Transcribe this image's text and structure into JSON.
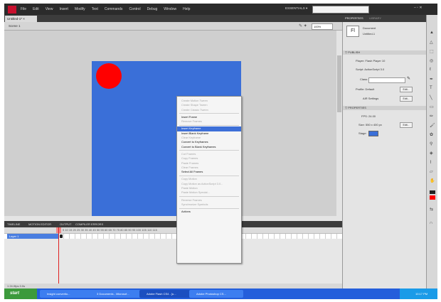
{
  "app": {
    "menu": [
      "File",
      "Edit",
      "View",
      "Insert",
      "Modify",
      "Text",
      "Commands",
      "Control",
      "Debug",
      "Window",
      "Help"
    ],
    "workspace": "ESSENTIALS ▾",
    "window_controls": "– ▫ ✕"
  },
  "document": {
    "tab": "Untitled-1* ×",
    "scene": "Scene 1",
    "zoom": "100%"
  },
  "context_menu": {
    "items": [
      {
        "label": "Create Motion Tween",
        "state": "dis"
      },
      {
        "label": "Create Shape Tween",
        "state": "dis"
      },
      {
        "label": "Create Classic Tween",
        "state": "dis"
      },
      {
        "sep": true
      },
      {
        "label": "Insert Frame",
        "state": "en"
      },
      {
        "label": "Remove Frames",
        "state": "dis"
      },
      {
        "sep": true
      },
      {
        "label": "Insert Keyframe",
        "state": "sel"
      },
      {
        "label": "Insert Blank Keyframe",
        "state": "en"
      },
      {
        "label": "Clear Keyframe",
        "state": "dis"
      },
      {
        "label": "Convert to Keyframes",
        "state": "en"
      },
      {
        "label": "Convert to Blank Keyframes",
        "state": "en"
      },
      {
        "sep": true
      },
      {
        "label": "Cut Frames",
        "state": "dis"
      },
      {
        "label": "Copy Frames",
        "state": "dis"
      },
      {
        "label": "Paste Frames",
        "state": "dis"
      },
      {
        "label": "Clear Frames",
        "state": "dis"
      },
      {
        "label": "Select All Frames",
        "state": "en"
      },
      {
        "sep": true
      },
      {
        "label": "Copy Motion",
        "state": "dis"
      },
      {
        "label": "Copy Motion as ActionScript 3.0...",
        "state": "dis"
      },
      {
        "label": "Paste Motion",
        "state": "dis"
      },
      {
        "label": "Paste Motion Special...",
        "state": "dis"
      },
      {
        "sep": true
      },
      {
        "label": "Reverse Frames",
        "state": "dis"
      },
      {
        "label": "Synchronize Symbols",
        "state": "dis"
      },
      {
        "sep": true
      },
      {
        "label": "Actions",
        "state": "en"
      }
    ]
  },
  "properties": {
    "tabs": [
      "PROPERTIES",
      "LIBRARY"
    ],
    "doc_label": "Document",
    "doc_name": "Untitled-1",
    "fl_icon": "Fl",
    "publish_header": "▽ PUBLISH",
    "player": "Player: Flash Player 10",
    "script": "Script: ActionScript 3.0",
    "class_label": "Class:",
    "profile": "Profile: Default",
    "edit_btn": "Edit...",
    "air": "AIR Settings",
    "props_header": "▽ PROPERTIES",
    "fps": "FPS: 24.00",
    "size": "Size: 550 x 400 px",
    "stage": "Stage:",
    "stage_color": "#3a6fd8"
  },
  "timeline": {
    "tabs": [
      "TIMELINE",
      "MOTION EDITOR",
      "OUTPUT",
      "COMPILER ERRORS"
    ],
    "layer": "Layer 1",
    "ruler": "5   10   15   20   25   30   35   40   45   50   55   60   65   70   75   80   85   90   95   100   105   110   115",
    "bottom": "1   24.0fps   0.0s"
  },
  "taskbar": {
    "start": "start",
    "tasks": [
      "Insight convertio...",
      "3 Documents - Microsof...",
      "Adobe Flash CS4 - [u...",
      "Adobe Photoshop CS..."
    ],
    "clock": "10:17 PM"
  }
}
